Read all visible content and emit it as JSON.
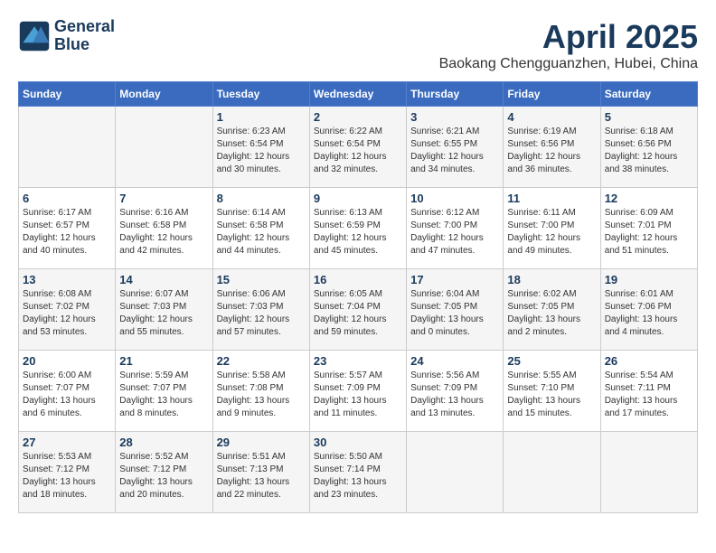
{
  "logo": {
    "line1": "General",
    "line2": "Blue"
  },
  "title": "April 2025",
  "location": "Baokang Chengguanzhen, Hubei, China",
  "days_of_week": [
    "Sunday",
    "Monday",
    "Tuesday",
    "Wednesday",
    "Thursday",
    "Friday",
    "Saturday"
  ],
  "weeks": [
    [
      {
        "day": null
      },
      {
        "day": null
      },
      {
        "day": "1",
        "sunrise": "6:23 AM",
        "sunset": "6:54 PM",
        "daylight": "12 hours and 30 minutes."
      },
      {
        "day": "2",
        "sunrise": "6:22 AM",
        "sunset": "6:54 PM",
        "daylight": "12 hours and 32 minutes."
      },
      {
        "day": "3",
        "sunrise": "6:21 AM",
        "sunset": "6:55 PM",
        "daylight": "12 hours and 34 minutes."
      },
      {
        "day": "4",
        "sunrise": "6:19 AM",
        "sunset": "6:56 PM",
        "daylight": "12 hours and 36 minutes."
      },
      {
        "day": "5",
        "sunrise": "6:18 AM",
        "sunset": "6:56 PM",
        "daylight": "12 hours and 38 minutes."
      }
    ],
    [
      {
        "day": "6",
        "sunrise": "6:17 AM",
        "sunset": "6:57 PM",
        "daylight": "12 hours and 40 minutes."
      },
      {
        "day": "7",
        "sunrise": "6:16 AM",
        "sunset": "6:58 PM",
        "daylight": "12 hours and 42 minutes."
      },
      {
        "day": "8",
        "sunrise": "6:14 AM",
        "sunset": "6:58 PM",
        "daylight": "12 hours and 44 minutes."
      },
      {
        "day": "9",
        "sunrise": "6:13 AM",
        "sunset": "6:59 PM",
        "daylight": "12 hours and 45 minutes."
      },
      {
        "day": "10",
        "sunrise": "6:12 AM",
        "sunset": "7:00 PM",
        "daylight": "12 hours and 47 minutes."
      },
      {
        "day": "11",
        "sunrise": "6:11 AM",
        "sunset": "7:00 PM",
        "daylight": "12 hours and 49 minutes."
      },
      {
        "day": "12",
        "sunrise": "6:09 AM",
        "sunset": "7:01 PM",
        "daylight": "12 hours and 51 minutes."
      }
    ],
    [
      {
        "day": "13",
        "sunrise": "6:08 AM",
        "sunset": "7:02 PM",
        "daylight": "12 hours and 53 minutes."
      },
      {
        "day": "14",
        "sunrise": "6:07 AM",
        "sunset": "7:03 PM",
        "daylight": "12 hours and 55 minutes."
      },
      {
        "day": "15",
        "sunrise": "6:06 AM",
        "sunset": "7:03 PM",
        "daylight": "12 hours and 57 minutes."
      },
      {
        "day": "16",
        "sunrise": "6:05 AM",
        "sunset": "7:04 PM",
        "daylight": "12 hours and 59 minutes."
      },
      {
        "day": "17",
        "sunrise": "6:04 AM",
        "sunset": "7:05 PM",
        "daylight": "13 hours and 0 minutes."
      },
      {
        "day": "18",
        "sunrise": "6:02 AM",
        "sunset": "7:05 PM",
        "daylight": "13 hours and 2 minutes."
      },
      {
        "day": "19",
        "sunrise": "6:01 AM",
        "sunset": "7:06 PM",
        "daylight": "13 hours and 4 minutes."
      }
    ],
    [
      {
        "day": "20",
        "sunrise": "6:00 AM",
        "sunset": "7:07 PM",
        "daylight": "13 hours and 6 minutes."
      },
      {
        "day": "21",
        "sunrise": "5:59 AM",
        "sunset": "7:07 PM",
        "daylight": "13 hours and 8 minutes."
      },
      {
        "day": "22",
        "sunrise": "5:58 AM",
        "sunset": "7:08 PM",
        "daylight": "13 hours and 9 minutes."
      },
      {
        "day": "23",
        "sunrise": "5:57 AM",
        "sunset": "7:09 PM",
        "daylight": "13 hours and 11 minutes."
      },
      {
        "day": "24",
        "sunrise": "5:56 AM",
        "sunset": "7:09 PM",
        "daylight": "13 hours and 13 minutes."
      },
      {
        "day": "25",
        "sunrise": "5:55 AM",
        "sunset": "7:10 PM",
        "daylight": "13 hours and 15 minutes."
      },
      {
        "day": "26",
        "sunrise": "5:54 AM",
        "sunset": "7:11 PM",
        "daylight": "13 hours and 17 minutes."
      }
    ],
    [
      {
        "day": "27",
        "sunrise": "5:53 AM",
        "sunset": "7:12 PM",
        "daylight": "13 hours and 18 minutes."
      },
      {
        "day": "28",
        "sunrise": "5:52 AM",
        "sunset": "7:12 PM",
        "daylight": "13 hours and 20 minutes."
      },
      {
        "day": "29",
        "sunrise": "5:51 AM",
        "sunset": "7:13 PM",
        "daylight": "13 hours and 22 minutes."
      },
      {
        "day": "30",
        "sunrise": "5:50 AM",
        "sunset": "7:14 PM",
        "daylight": "13 hours and 23 minutes."
      },
      {
        "day": null
      },
      {
        "day": null
      },
      {
        "day": null
      }
    ]
  ]
}
